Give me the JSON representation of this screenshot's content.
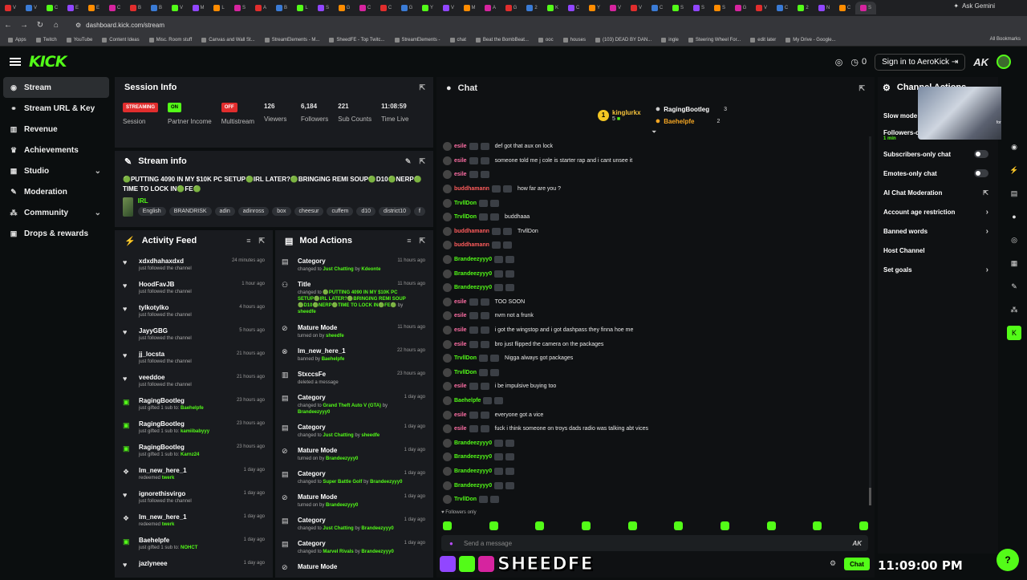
{
  "browser": {
    "tabs": [
      "V",
      "V",
      "C",
      "E",
      "E",
      "C",
      "B",
      "B",
      "V",
      "M",
      "L",
      "S",
      "A",
      "B",
      "L",
      "S",
      "G",
      "C",
      "C",
      "G",
      "Y",
      "V",
      "M",
      "A",
      "G",
      "2",
      "K",
      "C",
      "Y",
      "V",
      "V",
      "C",
      "S",
      "S",
      "S",
      "G",
      "V",
      "C",
      "2",
      "N",
      "C",
      "S"
    ],
    "ask_gemini": "Ask Gemini",
    "url": "dashboard.kick.com/stream",
    "bookmarks": [
      "Apps",
      "Twitch",
      "YouTube",
      "Content Ideas",
      "Misc. Room stuff",
      "Canvas and Wall St...",
      "StreamElements - M...",
      "SheedFE - Top Twitc...",
      "StreamElements -",
      "chat",
      "Beat the BombBeat...",
      "ooc",
      "houses",
      "(103) DEAD BY DAN...",
      "ingle",
      "Steering Wheel For...",
      "edit later",
      "My Drive - Google..."
    ],
    "all_bookmarks": "All Bookmarks"
  },
  "header": {
    "logo": "KICK",
    "viewer_count": "0",
    "signin_label": "Sign in to AeroKick",
    "ak_label": "AK"
  },
  "sidebar": {
    "items": [
      {
        "label": "Stream",
        "icon": "broadcast-icon"
      },
      {
        "label": "Stream URL & Key",
        "icon": "link-icon"
      },
      {
        "label": "Revenue",
        "icon": "chart-icon"
      },
      {
        "label": "Achievements",
        "icon": "trophy-icon"
      },
      {
        "label": "Studio",
        "icon": "studio-icon"
      },
      {
        "label": "Moderation",
        "icon": "wrench-icon"
      },
      {
        "label": "Community",
        "icon": "community-icon"
      },
      {
        "label": "Drops & rewards",
        "icon": "gift-icon"
      }
    ]
  },
  "session": {
    "title": "Session Info",
    "stats": [
      {
        "value": "STREAMING",
        "label": "Session"
      },
      {
        "value": "ON",
        "label": "Partner Income"
      },
      {
        "value": "OFF",
        "label": "Multistream"
      },
      {
        "value": "126",
        "label": "Viewers"
      },
      {
        "value": "6,184",
        "label": "Followers"
      },
      {
        "value": "221",
        "label": "Sub Counts"
      },
      {
        "value": "11:08:59",
        "label": "Time Live"
      }
    ]
  },
  "stream_info": {
    "title": "Stream info",
    "stream_title": "🟢PUTTING 4090 IN MY $10K PC SETUP🟢IRL LATER?🟢BRINGING REMI SOUP🟢D10🟢NERP🟢TIME TO LOCK IN🟢FE🟢",
    "category": "IRL",
    "tags": [
      "English",
      "BRANDRISK",
      "adin",
      "adinross",
      "box",
      "cheesur",
      "cuffem",
      "d10",
      "district10",
      "f"
    ]
  },
  "activity": {
    "title": "Activity Feed",
    "items": [
      {
        "name": "xdxdhahaxdxd",
        "desc": "just followed the channel",
        "highlight": "",
        "time": "24 minutes ago",
        "icon": "heart-icon"
      },
      {
        "name": "HoodFavJB",
        "desc": "just followed the channel",
        "highlight": "",
        "time": "1 hour ago",
        "icon": "heart-icon"
      },
      {
        "name": "tylkotylko",
        "desc": "just followed the channel",
        "highlight": "",
        "time": "4 hours ago",
        "icon": "heart-icon"
      },
      {
        "name": "JayyGBG",
        "desc": "just followed the channel",
        "highlight": "",
        "time": "5 hours ago",
        "icon": "heart-icon"
      },
      {
        "name": "jj_locsta",
        "desc": "just followed the channel",
        "highlight": "",
        "time": "21 hours ago",
        "icon": "heart-icon"
      },
      {
        "name": "veeddoe",
        "desc": "just followed the channel",
        "highlight": "",
        "time": "21 hours ago",
        "icon": "heart-icon"
      },
      {
        "name": "RagingBootleg",
        "desc": "just gifted 1 sub to:",
        "highlight": "Baehelpfe",
        "time": "23 hours ago",
        "icon": "gift-icon"
      },
      {
        "name": "RagingBootleg",
        "desc": "just gifted 1 sub to:",
        "highlight": "kamiibabyyy",
        "time": "23 hours ago",
        "icon": "gift-icon"
      },
      {
        "name": "RagingBootleg",
        "desc": "just gifted 1 sub to:",
        "highlight": "Karnz24",
        "time": "23 hours ago",
        "icon": "gift-icon"
      },
      {
        "name": "lm_new_here_1",
        "desc": "redeemed",
        "highlight": "twerk",
        "time": "1 day ago",
        "icon": "redeem-icon"
      },
      {
        "name": "ignorethisvirgo",
        "desc": "just followed the channel",
        "highlight": "",
        "time": "1 day ago",
        "icon": "heart-icon"
      },
      {
        "name": "lm_new_here_1",
        "desc": "redeemed",
        "highlight": "twerk",
        "time": "1 day ago",
        "icon": "redeem-icon"
      },
      {
        "name": "Baehelpfe",
        "desc": "just gifted 1 sub to:",
        "highlight": "NOHCT",
        "time": "1 day ago",
        "icon": "gift-icon"
      },
      {
        "name": "jazlyneee",
        "desc": "",
        "highlight": "",
        "time": "1 day ago",
        "icon": "heart-icon"
      }
    ]
  },
  "mod_actions": {
    "title": "Mod Actions",
    "items": [
      {
        "name": "Category",
        "pre": "changed to",
        "hl": "Just Chatting",
        "mid": "by",
        "by": "Kdeonte",
        "time": "11 hours ago",
        "icon": "category-icon"
      },
      {
        "name": "Title",
        "pre": "changed to",
        "hl": "🟢PUTTING 4090 IN MY $10K PC SETUP🟢IRL LATER?🟢BRINGING REMI SOUP🟢D10🟢NERP🟢TIME TO LOCK IN🟢FE🟢",
        "mid": "by",
        "by": "sheedfe",
        "time": "11 hours ago",
        "icon": "title-icon"
      },
      {
        "name": "Mature Mode",
        "pre": "turned on by",
        "hl": "",
        "mid": "",
        "by": "sheedfe",
        "time": "11 hours ago",
        "icon": "mature-icon"
      },
      {
        "name": "lm_new_here_1",
        "pre": "banned by",
        "hl": "",
        "mid": "",
        "by": "Baehelpfe",
        "time": "22 hours ago",
        "icon": "ban-icon"
      },
      {
        "name": "StxccsFe",
        "pre": "deleted a message",
        "hl": "",
        "mid": "",
        "by": "",
        "time": "23 hours ago",
        "icon": "delete-icon"
      },
      {
        "name": "Category",
        "pre": "changed to",
        "hl": "Grand Theft Auto V (GTA)",
        "mid": "by",
        "by": "Brandeezyyy0",
        "time": "1 day ago",
        "icon": "category-icon"
      },
      {
        "name": "Category",
        "pre": "changed to",
        "hl": "Just Chatting",
        "mid": "by",
        "by": "sheedfe",
        "time": "1 day ago",
        "icon": "category-icon"
      },
      {
        "name": "Mature Mode",
        "pre": "turned on by",
        "hl": "",
        "mid": "",
        "by": "Brandeezyyy0",
        "time": "1 day ago",
        "icon": "mature-icon"
      },
      {
        "name": "Category",
        "pre": "changed to",
        "hl": "Super Battle Golf",
        "mid": "by",
        "by": "Brandeezyyy0",
        "time": "1 day ago",
        "icon": "category-icon"
      },
      {
        "name": "Mature Mode",
        "pre": "turned on by",
        "hl": "",
        "mid": "",
        "by": "Brandeezyyy0",
        "time": "1 day ago",
        "icon": "mature-icon"
      },
      {
        "name": "Category",
        "pre": "changed to",
        "hl": "Just Chatting",
        "mid": "by",
        "by": "Brandeezyyy0",
        "time": "1 day ago",
        "icon": "category-icon"
      },
      {
        "name": "Category",
        "pre": "changed to",
        "hl": "Marvel Rivals",
        "mid": "by",
        "by": "Brandeezyyy0",
        "time": "1 day ago",
        "icon": "category-icon"
      },
      {
        "name": "Mature Mode",
        "pre": "",
        "hl": "",
        "mid": "",
        "by": "",
        "time": "",
        "icon": "mature-icon"
      }
    ]
  },
  "chat": {
    "title": "Chat",
    "gifters": [
      {
        "name": "kinglurkx",
        "count": "5"
      },
      {
        "name": "RagingBootleg",
        "count": "3"
      },
      {
        "name": "Baehelpfe",
        "count": "2"
      }
    ],
    "messages": [
      {
        "user": "esile",
        "color": "#ff6fa5",
        "msg": "def got that aux on lock"
      },
      {
        "user": "esile",
        "color": "#ff6fa5",
        "msg": "someone told me j cole is starter rap and i cant unsee it"
      },
      {
        "user": "esile",
        "color": "#ff6fa5",
        "msg": ""
      },
      {
        "user": "buddhamann",
        "color": "#ff5c5c",
        "msg": "how far are you ?"
      },
      {
        "user": "TrvllDon",
        "color": "#53fc18",
        "msg": ""
      },
      {
        "user": "TrvllDon",
        "color": "#53fc18",
        "msg": "buddhaaa"
      },
      {
        "user": "buddhamann",
        "color": "#ff5c5c",
        "msg": "TrvllDon"
      },
      {
        "user": "buddhamann",
        "color": "#ff5c5c",
        "msg": ""
      },
      {
        "user": "Brandeezyyy0",
        "color": "#53fc18",
        "msg": ""
      },
      {
        "user": "Brandeezyyy0",
        "color": "#53fc18",
        "msg": ""
      },
      {
        "user": "Brandeezyyy0",
        "color": "#53fc18",
        "msg": ""
      },
      {
        "user": "esile",
        "color": "#ff6fa5",
        "msg": "TOO SOON"
      },
      {
        "user": "esile",
        "color": "#ff6fa5",
        "msg": "nvm not a frunk"
      },
      {
        "user": "esile",
        "color": "#ff6fa5",
        "msg": "i got the wingstop and i got dashpass they finna hoe me"
      },
      {
        "user": "esile",
        "color": "#ff6fa5",
        "msg": "bro just flipped the camera on the packages"
      },
      {
        "user": "TrvllDon",
        "color": "#53fc18",
        "msg": "Nigga always got packages"
      },
      {
        "user": "TrvllDon",
        "color": "#53fc18",
        "msg": ""
      },
      {
        "user": "esile",
        "color": "#ff6fa5",
        "msg": "i be impulsive buying too"
      },
      {
        "user": "Baehelpfe",
        "color": "#53fc18",
        "msg": ""
      },
      {
        "user": "esile",
        "color": "#ff6fa5",
        "msg": "everyone got a vice"
      },
      {
        "user": "esile",
        "color": "#ff6fa5",
        "msg": "fuck i think someone on troys dads radio was talking abt vices"
      },
      {
        "user": "Brandeezyyy0",
        "color": "#53fc18",
        "msg": ""
      },
      {
        "user": "Brandeezyyy0",
        "color": "#53fc18",
        "msg": ""
      },
      {
        "user": "Brandeezyyy0",
        "color": "#53fc18",
        "msg": ""
      },
      {
        "user": "Brandeezyyy0",
        "color": "#53fc18",
        "msg": ""
      },
      {
        "user": "TrvllDon",
        "color": "#53fc18",
        "msg": ""
      }
    ],
    "followers_only": "Followers only",
    "input_placeholder": "Send a message",
    "send_label": "Chat",
    "overlay_name": "SHEEDFE"
  },
  "channel_actions": {
    "title": "Channel Actions",
    "rows": [
      {
        "label": "Slow mode",
        "type": "text"
      },
      {
        "label": "Followers-o",
        "sub": "1 min",
        "type": "text"
      },
      {
        "label": "Subscribers-only chat",
        "type": "toggle"
      },
      {
        "label": "Emotes-only chat",
        "type": "toggle"
      },
      {
        "label": "AI Chat Moderation",
        "type": "ext"
      },
      {
        "label": "Account age restriction",
        "type": "chev"
      },
      {
        "label": "Banned words",
        "type": "chev"
      },
      {
        "label": "Host Channel",
        "type": "none"
      },
      {
        "label": "Set goals",
        "type": "chev"
      }
    ],
    "video_text": "for fun"
  },
  "clock": "11:09:00 PM",
  "colors": {
    "accent": "#53fc18",
    "live": "#e12d2d"
  }
}
